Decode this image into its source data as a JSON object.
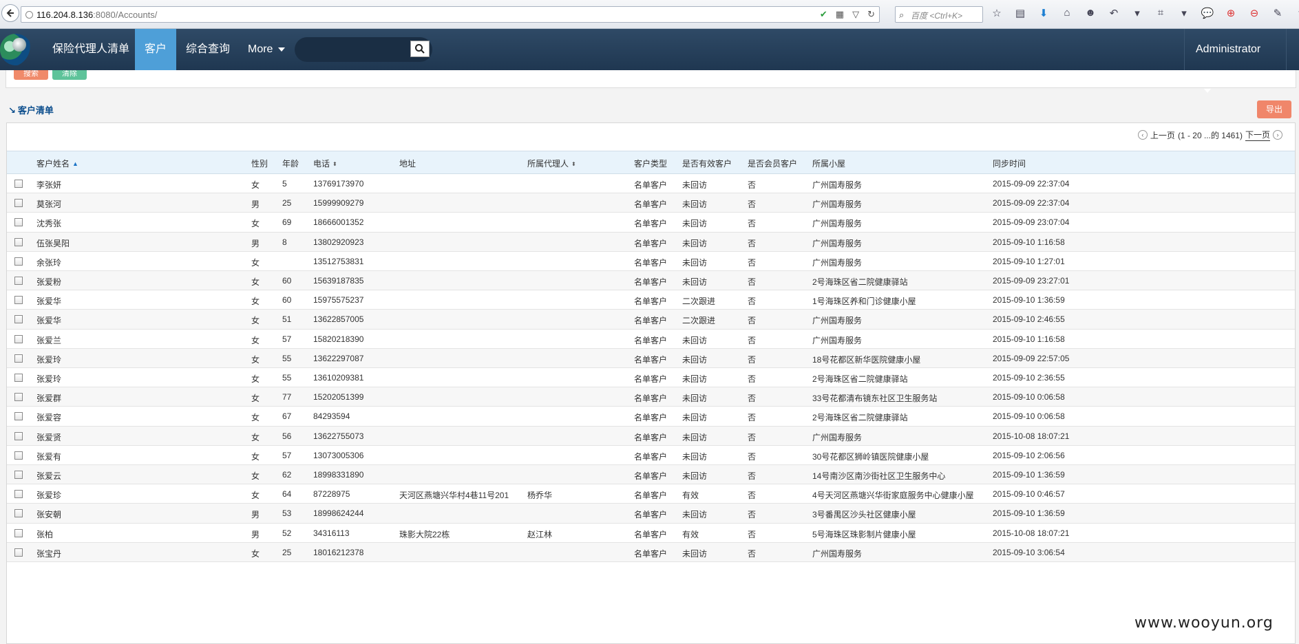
{
  "browser": {
    "url_host": "116.204.8.136",
    "url_rest": ":8080/Accounts/",
    "search_placeholder": "百度 <Ctrl+K>"
  },
  "nav": {
    "items": [
      {
        "label": "保险代理人清单"
      },
      {
        "label": "客户"
      },
      {
        "label": "综合查询"
      },
      {
        "label": "More"
      }
    ],
    "user": "Administrator"
  },
  "filter": {
    "search_label": "搜索",
    "clear_label": "清除"
  },
  "section": {
    "title": "客户清单",
    "export_label": "导出"
  },
  "pager": {
    "prev": "上一页",
    "range": "(1 - 20 ...的 1461)",
    "next": "下一页"
  },
  "columns": [
    "客户姓名",
    "性别",
    "年龄",
    "电话",
    "地址",
    "所属代理人",
    "客户类型",
    "是否有效客户",
    "是否会员客户",
    "所属小屋",
    "同步时间"
  ],
  "rows": [
    [
      "李张妍",
      "女",
      "5",
      "13769173970",
      "",
      "",
      "名单客户",
      "未回访",
      "否",
      "广州国寿服务",
      "2015-09-09 22:37:04"
    ],
    [
      "莫张河",
      "男",
      "25",
      "15999909279",
      "",
      "",
      "名单客户",
      "未回访",
      "否",
      "广州国寿服务",
      "2015-09-09 22:37:04"
    ],
    [
      "沈秀张",
      "女",
      "69",
      "18666001352",
      "",
      "",
      "名单客户",
      "未回访",
      "否",
      "广州国寿服务",
      "2015-09-09 23:07:04"
    ],
    [
      "伍张昊阳",
      "男",
      "8",
      "13802920923",
      "",
      "",
      "名单客户",
      "未回访",
      "否",
      "广州国寿服务",
      "2015-09-10 1:16:58"
    ],
    [
      "余张玲",
      "女",
      "",
      "13512753831",
      "",
      "",
      "名单客户",
      "未回访",
      "否",
      "广州国寿服务",
      "2015-09-10 1:27:01"
    ],
    [
      "张爱粉",
      "女",
      "60",
      "15639187835",
      "",
      "",
      "名单客户",
      "未回访",
      "否",
      "2号海珠区省二院健康驿站",
      "2015-09-09 23:27:01"
    ],
    [
      "张爱华",
      "女",
      "60",
      "15975575237",
      "",
      "",
      "名单客户",
      "二次跟进",
      "否",
      "1号海珠区养和门诊健康小屋",
      "2015-09-10 1:36:59"
    ],
    [
      "张爱华",
      "女",
      "51",
      "13622857005",
      "",
      "",
      "名单客户",
      "二次跟进",
      "否",
      "广州国寿服务",
      "2015-09-10 2:46:55"
    ],
    [
      "张爱兰",
      "女",
      "57",
      "15820218390",
      "",
      "",
      "名单客户",
      "未回访",
      "否",
      "广州国寿服务",
      "2015-09-10 1:16:58"
    ],
    [
      "张爱玲",
      "女",
      "55",
      "13622297087",
      "",
      "",
      "名单客户",
      "未回访",
      "否",
      "18号花都区新华医院健康小屋",
      "2015-09-09 22:57:05"
    ],
    [
      "张爱玲",
      "女",
      "55",
      "13610209381",
      "",
      "",
      "名单客户",
      "未回访",
      "否",
      "2号海珠区省二院健康驿站",
      "2015-09-10 2:36:55"
    ],
    [
      "张爱群",
      "女",
      "77",
      "15202051399",
      "",
      "",
      "名单客户",
      "未回访",
      "否",
      "33号花都清布镜东社区卫生服务站",
      "2015-09-10 0:06:58"
    ],
    [
      "张爱容",
      "女",
      "67",
      "84293594",
      "",
      "",
      "名单客户",
      "未回访",
      "否",
      "2号海珠区省二院健康驿站",
      "2015-09-10 0:06:58"
    ],
    [
      "张爱贤",
      "女",
      "56",
      "13622755073",
      "",
      "",
      "名单客户",
      "未回访",
      "否",
      "广州国寿服务",
      "2015-10-08 18:07:21"
    ],
    [
      "张爱有",
      "女",
      "57",
      "13073005306",
      "",
      "",
      "名单客户",
      "未回访",
      "否",
      "30号花都区狮岭镇医院健康小屋",
      "2015-09-10 2:06:56"
    ],
    [
      "张爱云",
      "女",
      "62",
      "18998331890",
      "",
      "",
      "名单客户",
      "未回访",
      "否",
      "14号南沙区南沙街社区卫生服务中心",
      "2015-09-10 1:36:59"
    ],
    [
      "张爱珍",
      "女",
      "64",
      "87228975",
      "天河区燕塘兴华村4巷11号201",
      "杨乔华",
      "名单客户",
      "有效",
      "否",
      "4号天河区燕塘兴华街家庭服务中心健康小屋",
      "2015-09-10 0:46:57"
    ],
    [
      "张安朝",
      "男",
      "53",
      "18998624244",
      "",
      "",
      "名单客户",
      "未回访",
      "否",
      "3号番禺区沙头社区健康小屋",
      "2015-09-10 1:36:59"
    ],
    [
      "张柏",
      "男",
      "52",
      "34316113",
      "珠影大院22栋",
      "赵江林",
      "名单客户",
      "有效",
      "否",
      "5号海珠区珠影制片健康小屋",
      "2015-10-08 18:07:21"
    ],
    [
      "张宝丹",
      "女",
      "25",
      "18016212378",
      "",
      "",
      "名单客户",
      "未回访",
      "否",
      "广州国寿服务",
      "2015-09-10 3:06:54"
    ]
  ],
  "watermark": "www.wooyun.org"
}
